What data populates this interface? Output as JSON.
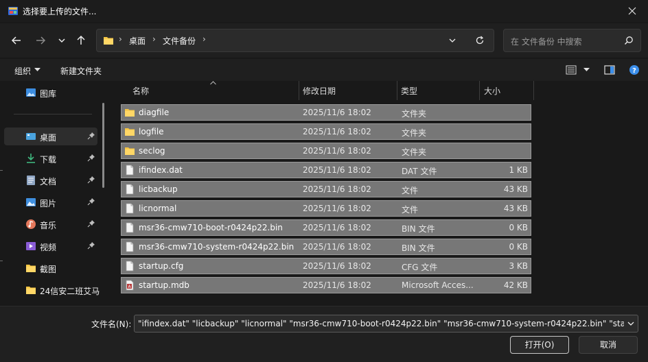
{
  "window": {
    "title": "选择要上传的文件..."
  },
  "nav": {
    "breadcrumb": [
      "桌面",
      "文件备份"
    ]
  },
  "search": {
    "placeholder": "在 文件备份 中搜索"
  },
  "toolbar": {
    "organize_label": "组织",
    "new_folder_label": "新建文件夹"
  },
  "sidebar": {
    "items": [
      {
        "label": "图库",
        "icon": "gallery-icon",
        "pinned": false,
        "active": false
      },
      {
        "label": "桌面",
        "icon": "desktop-icon",
        "pinned": true,
        "active": true
      },
      {
        "label": "下载",
        "icon": "download-icon",
        "pinned": true,
        "active": false
      },
      {
        "label": "文档",
        "icon": "document-icon",
        "pinned": true,
        "active": false
      },
      {
        "label": "图片",
        "icon": "pictures-icon",
        "pinned": true,
        "active": false
      },
      {
        "label": "音乐",
        "icon": "music-icon",
        "pinned": true,
        "active": false
      },
      {
        "label": "视频",
        "icon": "video-icon",
        "pinned": true,
        "active": false
      },
      {
        "label": "截图",
        "icon": "folder-icon",
        "pinned": false,
        "active": false
      },
      {
        "label": "24信安二班艾马",
        "icon": "folder-icon",
        "pinned": false,
        "active": false
      }
    ]
  },
  "columns": {
    "name": "名称",
    "date": "修改日期",
    "type": "类型",
    "size": "大小"
  },
  "files": [
    {
      "name": "diagfile",
      "date": "2025/11/6 18:02",
      "type": "文件夹",
      "size": "",
      "kind": "folder"
    },
    {
      "name": "logfile",
      "date": "2025/11/6 18:02",
      "type": "文件夹",
      "size": "",
      "kind": "folder"
    },
    {
      "name": "seclog",
      "date": "2025/11/6 18:02",
      "type": "文件夹",
      "size": "",
      "kind": "folder"
    },
    {
      "name": "ifindex.dat",
      "date": "2025/11/6 18:02",
      "type": "DAT 文件",
      "size": "1 KB",
      "kind": "file"
    },
    {
      "name": "licbackup",
      "date": "2025/11/6 18:02",
      "type": "文件",
      "size": "43 KB",
      "kind": "file"
    },
    {
      "name": "licnormal",
      "date": "2025/11/6 18:02",
      "type": "文件",
      "size": "43 KB",
      "kind": "file"
    },
    {
      "name": "msr36-cmw710-boot-r0424p22.bin",
      "date": "2025/11/6 18:02",
      "type": "BIN 文件",
      "size": "0 KB",
      "kind": "file"
    },
    {
      "name": "msr36-cmw710-system-r0424p22.bin",
      "date": "2025/11/6 18:02",
      "type": "BIN 文件",
      "size": "0 KB",
      "kind": "file"
    },
    {
      "name": "startup.cfg",
      "date": "2025/11/6 18:02",
      "type": "CFG 文件",
      "size": "3 KB",
      "kind": "file"
    },
    {
      "name": "startup.mdb",
      "date": "2025/11/6 18:02",
      "type": "Microsoft Acces...",
      "size": "42 KB",
      "kind": "access"
    }
  ],
  "bottom": {
    "filename_label": "文件名(N):",
    "filename_value": "\"ifindex.dat\" \"licbackup\" \"licnormal\" \"msr36-cmw710-boot-r0424p22.bin\" \"msr36-cmw710-system-r0424p22.bin\" \"startup.cfg\" \"startup.mdb\"",
    "open_label": "打开(O)",
    "cancel_label": "取消"
  }
}
